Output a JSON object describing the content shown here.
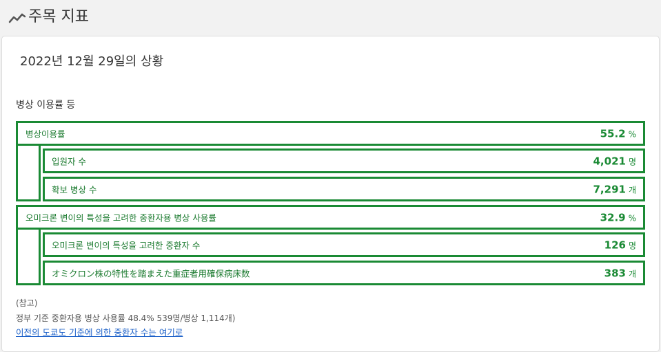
{
  "header": {
    "title": "주목 지표"
  },
  "main": {
    "date_title": "2022년 12월 29일의 상황",
    "section_title": "병상 이용률 등",
    "rows": [
      {
        "label": "병상이용률",
        "value": "55.2",
        "unit": "%"
      },
      {
        "label": "입원자 수",
        "value": "4,021",
        "unit": "명"
      },
      {
        "label": "확보 병상 수",
        "value": "7,291",
        "unit": "개"
      },
      {
        "label": "오미크론 변이의 특성을 고려한 중환자용 병상 사용률",
        "value": "32.9",
        "unit": "%"
      },
      {
        "label": "오미크론 변이의 특성을 고려한 중환자 수",
        "value": "126",
        "unit": "명"
      },
      {
        "label": "オミクロン株の特性を踏まえた重症者用確保病床数",
        "value": "383",
        "unit": "개"
      }
    ],
    "note_heading": "(참고)",
    "note_text": "정부 기준 중환자용 병상 사용률 48.4% 539명/병상 1,114개)",
    "note_link": "이전의 도쿄도 기준에 의한 중환자 수는 여기로"
  },
  "colors": {
    "accent_green": "#1a8a34",
    "link_blue": "#1a5fc8"
  }
}
